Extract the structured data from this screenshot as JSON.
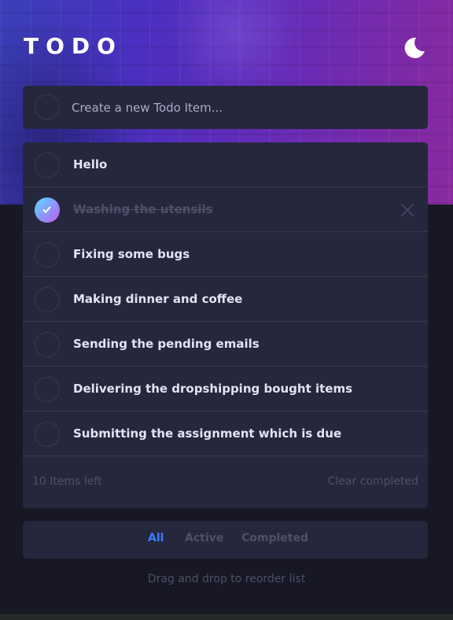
{
  "app": {
    "title": "TODO",
    "theme_icon": "moon-icon"
  },
  "new_todo": {
    "placeholder": "Create a new Todo Item..."
  },
  "todos": [
    {
      "label": "Hello",
      "completed": false
    },
    {
      "label": "Washing the utensils",
      "completed": true
    },
    {
      "label": "Fixing some bugs",
      "completed": false
    },
    {
      "label": "Making dinner and coffee",
      "completed": false
    },
    {
      "label": "Sending the pending emails",
      "completed": false
    },
    {
      "label": "Delivering the dropshipping bought items",
      "completed": false
    },
    {
      "label": "Submitting the assignment which is due",
      "completed": false
    }
  ],
  "footer": {
    "items_left": "10 Items left",
    "clear_completed": "Clear completed"
  },
  "filters": {
    "all": "All",
    "active": "Active",
    "completed": "Completed",
    "selected": "All"
  },
  "hint": "Drag and drop to reorder list",
  "colors": {
    "background": "#171823",
    "card": "#25273D",
    "accent": "#3A7CFD",
    "check_gradient_start": "#55DDFF",
    "check_gradient_end": "#C058F3"
  }
}
